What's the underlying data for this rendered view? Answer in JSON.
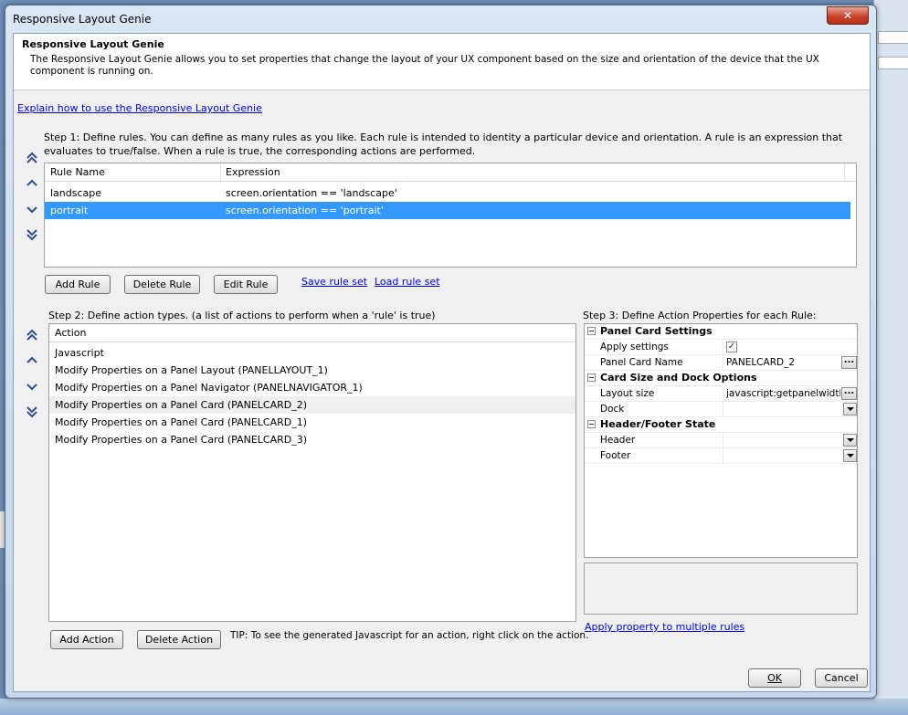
{
  "window": {
    "title": "Responsive Layout Genie",
    "close_glyph": "✕"
  },
  "header": {
    "title": "Responsive Layout Genie",
    "description": "The Responsive Layout Genie allows you to set properties that change the layout of your UX component based on the size and orientation of the device that the UX component is running on."
  },
  "explain_link": "Explain how to use the Responsive Layout Genie",
  "step1": {
    "text": "Step 1: Define rules. You can define as many rules as you like. Each rule is intended to identity a particular device and orientation. A rule is an expression that evaluates to true/false. When a rule is true, the corresponding actions are performed.",
    "columns": [
      "Rule Name",
      "Expression"
    ],
    "rows": [
      {
        "name": "landscape",
        "expression": "screen.orientation == 'landscape'"
      },
      {
        "name": "portrait",
        "expression": "screen.orientation == 'portrait'"
      }
    ],
    "selected_index": 1,
    "buttons": {
      "add": "Add Rule",
      "delete": "Delete Rule",
      "edit": "Edit Rule"
    },
    "links": {
      "save": "Save rule set",
      "load": "Load rule set"
    }
  },
  "step2": {
    "text": "Step 2: Define action types. (a list of actions to perform when a 'rule' is true)",
    "column": "Action",
    "rows": [
      "Javascript",
      "Modify Properties on a Panel Layout (PANELLAYOUT_1)",
      "Modify Properties on a Panel Navigator (PANELNAVIGATOR_1)",
      "Modify Properties on a Panel Card (PANELCARD_2)",
      "Modify Properties on a Panel Card (PANELCARD_1)",
      "Modify Properties on a Panel Card (PANELCARD_3)"
    ],
    "highlighted_index": 3,
    "buttons": {
      "add": "Add Action",
      "delete": "Delete Action"
    },
    "tip": "TIP: To see the generated Javascript for an action, right click on the action."
  },
  "step3": {
    "text": "Step 3: Define Action Properties for each Rule:",
    "categories": {
      "panel_card": "Panel Card Settings",
      "card_size": "Card Size and Dock Options",
      "header_footer": "Header/Footer State"
    },
    "props": {
      "apply_settings": {
        "label": "Apply settings",
        "checked": true,
        "check_glyph": "✓"
      },
      "panel_card_name": {
        "label": "Panel Card Name",
        "value": "PANELCARD_2"
      },
      "layout_size": {
        "label": "Layout size",
        "value": "javascript:getpanelwidth(sc"
      },
      "dock": {
        "label": "Dock",
        "value": ""
      },
      "header": {
        "label": "Header",
        "value": ""
      },
      "footer": {
        "label": "Footer",
        "value": ""
      }
    },
    "ellipsis_glyph": "...",
    "apply_link": "Apply property to multiple rules"
  },
  "footer": {
    "ok": "OK",
    "cancel": "Cancel"
  }
}
